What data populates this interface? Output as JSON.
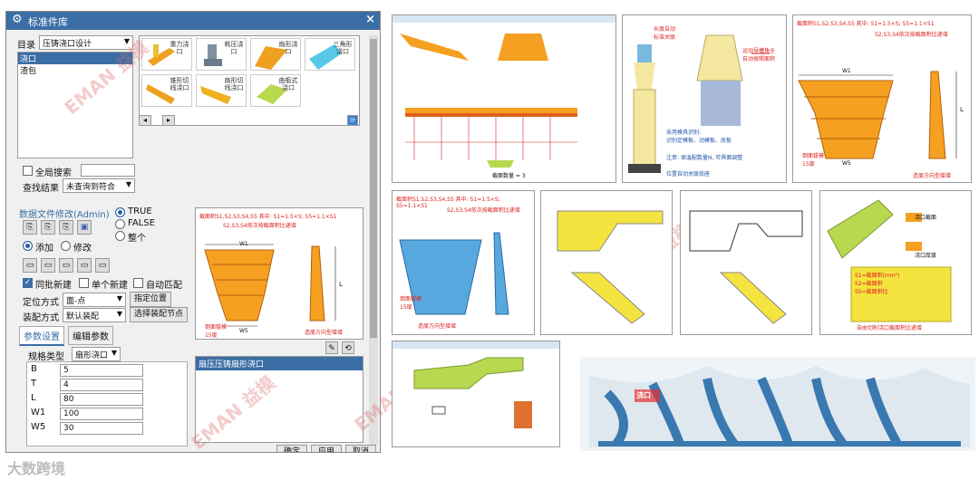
{
  "dialog": {
    "title": "标准件库",
    "close": "×",
    "catalog_label": "目录",
    "catalog_value": "压铸浇口设计",
    "tree": [
      "浇口",
      "渣包"
    ],
    "tiles": [
      "重力浇口",
      "耗压浇口",
      "扇形浇口",
      "三角形浇口",
      "锥形切线浇口",
      "扇形切线浇口",
      "曲板式浇口"
    ],
    "global_search": "全局搜索",
    "search_result_label": "查找结果",
    "search_result_value": "未查询到符合",
    "data_file_edit": "数据文件修改(Admin)",
    "radio_true": "TRUE",
    "radio_false": "FALSE",
    "radio_whole": "整个",
    "add": "添加",
    "modify": "修改",
    "batch_new": "同批新建",
    "single_new": "单个新建",
    "auto_match": "自动匹配",
    "position_label": "定位方式",
    "position_value": "面-点",
    "specify_position": "指定位置",
    "assembly_label": "装配方式",
    "assembly_value": "默认装配",
    "select_node": "选择装配节点",
    "tab_params": "参数设置",
    "tab_edit": "编辑参数",
    "spec_type_label": "规格类型",
    "spec_type_value": "扇形浇口",
    "params": [
      {
        "name": "B",
        "value": "5"
      },
      {
        "name": "T",
        "value": "4"
      },
      {
        "name": "L",
        "value": "80"
      },
      {
        "name": "W1",
        "value": "100"
      },
      {
        "name": "W5",
        "value": "30"
      }
    ],
    "preview_list_item": "扇压压铸扇形浇口",
    "ok": "确定",
    "apply": "应用",
    "cancel": "取消"
  },
  "preview_caption": "截面积S1,S2,S3,S4,S5  其中: S1=1.5×S; S5=1.1×S1",
  "preview_caption2": "S2,S3,S4依次按截面积比递增",
  "preview_notes": {
    "w1": "W1",
    "w5": "W5",
    "l": "L",
    "slope": "倒面拔模\n15度",
    "dir": "造度方向型增增"
  },
  "watermark": "EMAN 益模",
  "brand": "大数跨境",
  "images": {
    "img1_text": "截面数量 = 3",
    "img2_note1": "长度自动\n标准关联",
    "img2_note2": "运动导槽角全\n自动按照面积",
    "img2_note3": "采用模具识别:\n识别定模板、动模板、底板",
    "img2_note4": "注意: 保温配数量N, 可界面调整",
    "img2_note5": "位置自动关联底座",
    "img3_cap": "截面积S1,S2,S3,S4,S5  其中: S1=1.5×S; S5=1.1×S1",
    "img3_cap2": "S2,S3,S4依次按截面积比递增",
    "img3_w1": "W1",
    "img3_w5": "W5",
    "img3_l": "L",
    "img3_slope": "倒面拔模\n15度",
    "img3_dir": "造度方向型增增",
    "img4_cap": "截面积S1,S2,S3,S4,S5  其中: S1=1.5×S; S5=1.1×S1",
    "img4_cap2": "S2,S3,S4依次按截面积比递增",
    "img4_slope": "倒面拔模\n15度",
    "img4_dir": "造度方向型增增",
    "img7_t1": "浇口截面",
    "img7_t2": "浇口厚度",
    "img7_t3": "S1=截面积(mm²)\nS2=截面积\nS5=截面积比",
    "img7_t4": "自由切削浇口截面积比递增",
    "img9_t1": "浇口"
  }
}
